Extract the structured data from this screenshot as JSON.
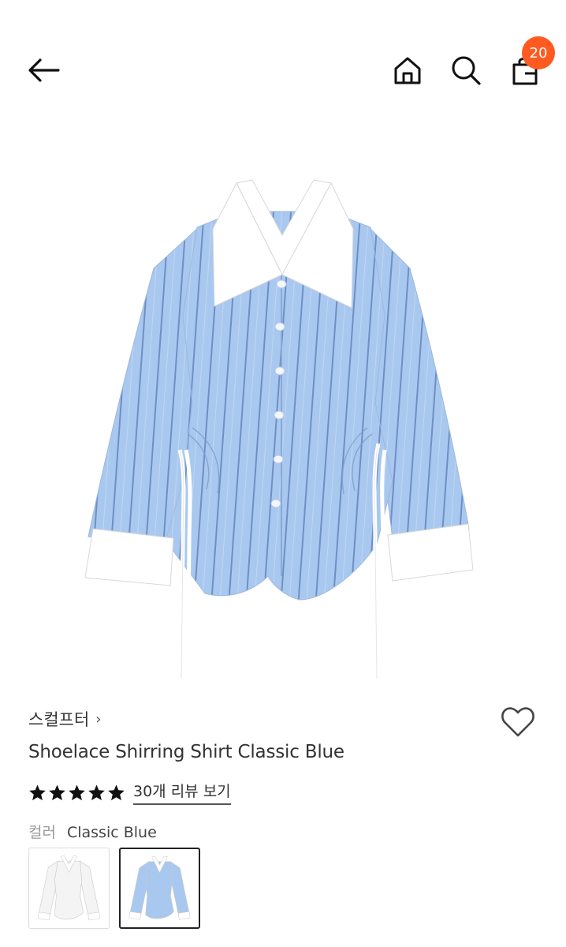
{
  "header": {
    "back_icon": "arrow-left-icon",
    "home_icon": "home-icon",
    "search_icon": "search-icon",
    "bag_icon": "shopping-bag-icon",
    "cart_count": "20",
    "badge_color": "#ff5a1f"
  },
  "product": {
    "brand": "스컬프터",
    "brand_chevron": "›",
    "title": "Shoelace Shirring Shirt Classic Blue",
    "rating": 5,
    "rating_max": 5,
    "review_link": "30개 리뷰 보기",
    "like_icon": "heart-outline-icon",
    "image_icon": "striped-shirt-image"
  },
  "color": {
    "label": "컬러",
    "value": "Classic Blue",
    "options": [
      {
        "name": "white",
        "swatch_color": "#f4f4f4",
        "selected": false
      },
      {
        "name": "classic-blue",
        "swatch_color": "#a9c8ef",
        "selected": true
      }
    ]
  }
}
